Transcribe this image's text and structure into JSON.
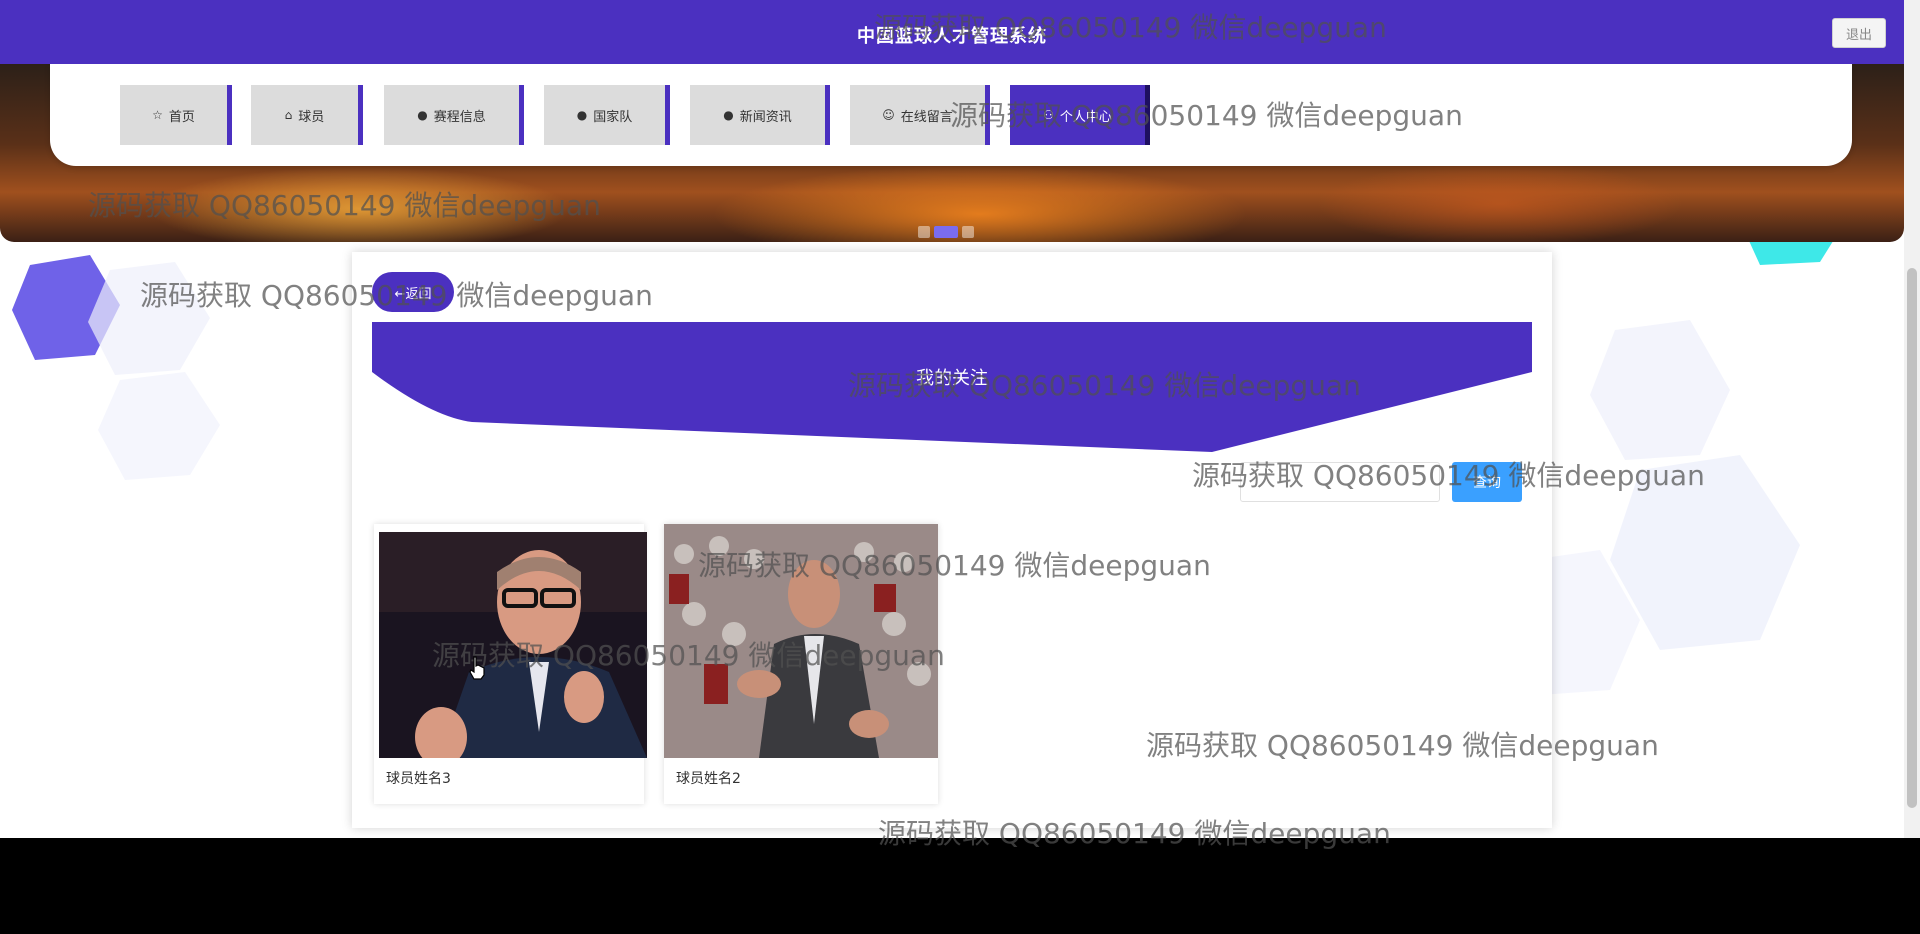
{
  "header": {
    "title": "中国篮球人才管理系统",
    "logout_label": "退出"
  },
  "nav": [
    {
      "label": "首页",
      "icon": "star-icon",
      "glyph": "☆"
    },
    {
      "label": "球员",
      "icon": "bag-icon",
      "glyph": "⌂"
    },
    {
      "label": "赛程信息",
      "icon": "info-icon",
      "glyph": "●"
    },
    {
      "label": "国家队",
      "icon": "question-icon",
      "glyph": "●"
    },
    {
      "label": "新闻资讯",
      "icon": "info-icon",
      "glyph": "●"
    },
    {
      "label": "在线留言",
      "icon": "smile-icon",
      "glyph": "☺"
    },
    {
      "label": "个人中心",
      "icon": "user-icon",
      "glyph": "⚇",
      "active": true
    }
  ],
  "carousel": {
    "slides": 3,
    "active_index": 1
  },
  "page": {
    "back_label": "←返回",
    "section_title": "我的关注",
    "search_placeholder": "",
    "search_button": "查询"
  },
  "favorites": [
    {
      "name": "球员姓名3"
    },
    {
      "name": "球员姓名2"
    }
  ],
  "watermark_text": "源码获取 QQ86050149 微信deepguan",
  "colors": {
    "primary": "#4b30c0",
    "search_button": "#3aa0ff",
    "nav_inactive": "#dcdcdc"
  }
}
